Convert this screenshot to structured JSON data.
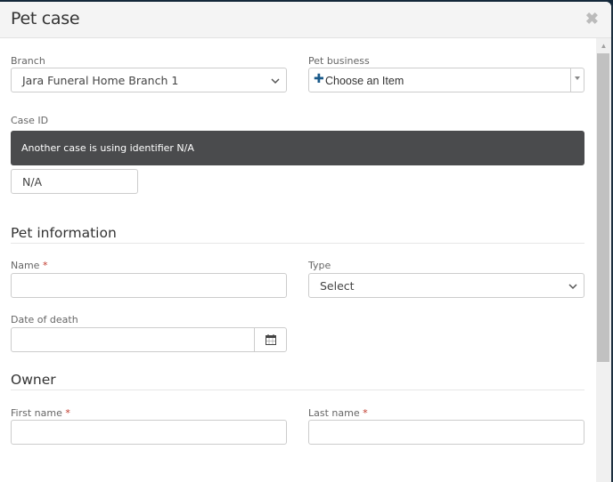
{
  "modal": {
    "title": "Pet case",
    "close_icon": "close-icon"
  },
  "branch": {
    "label": "Branch",
    "value": "Jara Funeral Home Branch 1"
  },
  "pet_business": {
    "label": "Pet business",
    "value": "Choose an Item",
    "icon": "plus-icon"
  },
  "case_id": {
    "label": "Case ID",
    "alert": "Another case is using identifier N/A",
    "value": "N/A"
  },
  "pet_information": {
    "title": "Pet information",
    "name_label": "Name",
    "name_value": "",
    "type_label": "Type",
    "type_value": "Select",
    "date_of_death_label": "Date of death",
    "date_of_death_value": ""
  },
  "owner": {
    "title": "Owner",
    "first_name_label": "First name",
    "first_name_value": "",
    "last_name_label": "Last name",
    "last_name_value": ""
  },
  "required_marker": "*",
  "colors": {
    "alert_bg": "#4a4b4d",
    "required": "#c0392b",
    "plus_icon": "#1a5a8a"
  }
}
